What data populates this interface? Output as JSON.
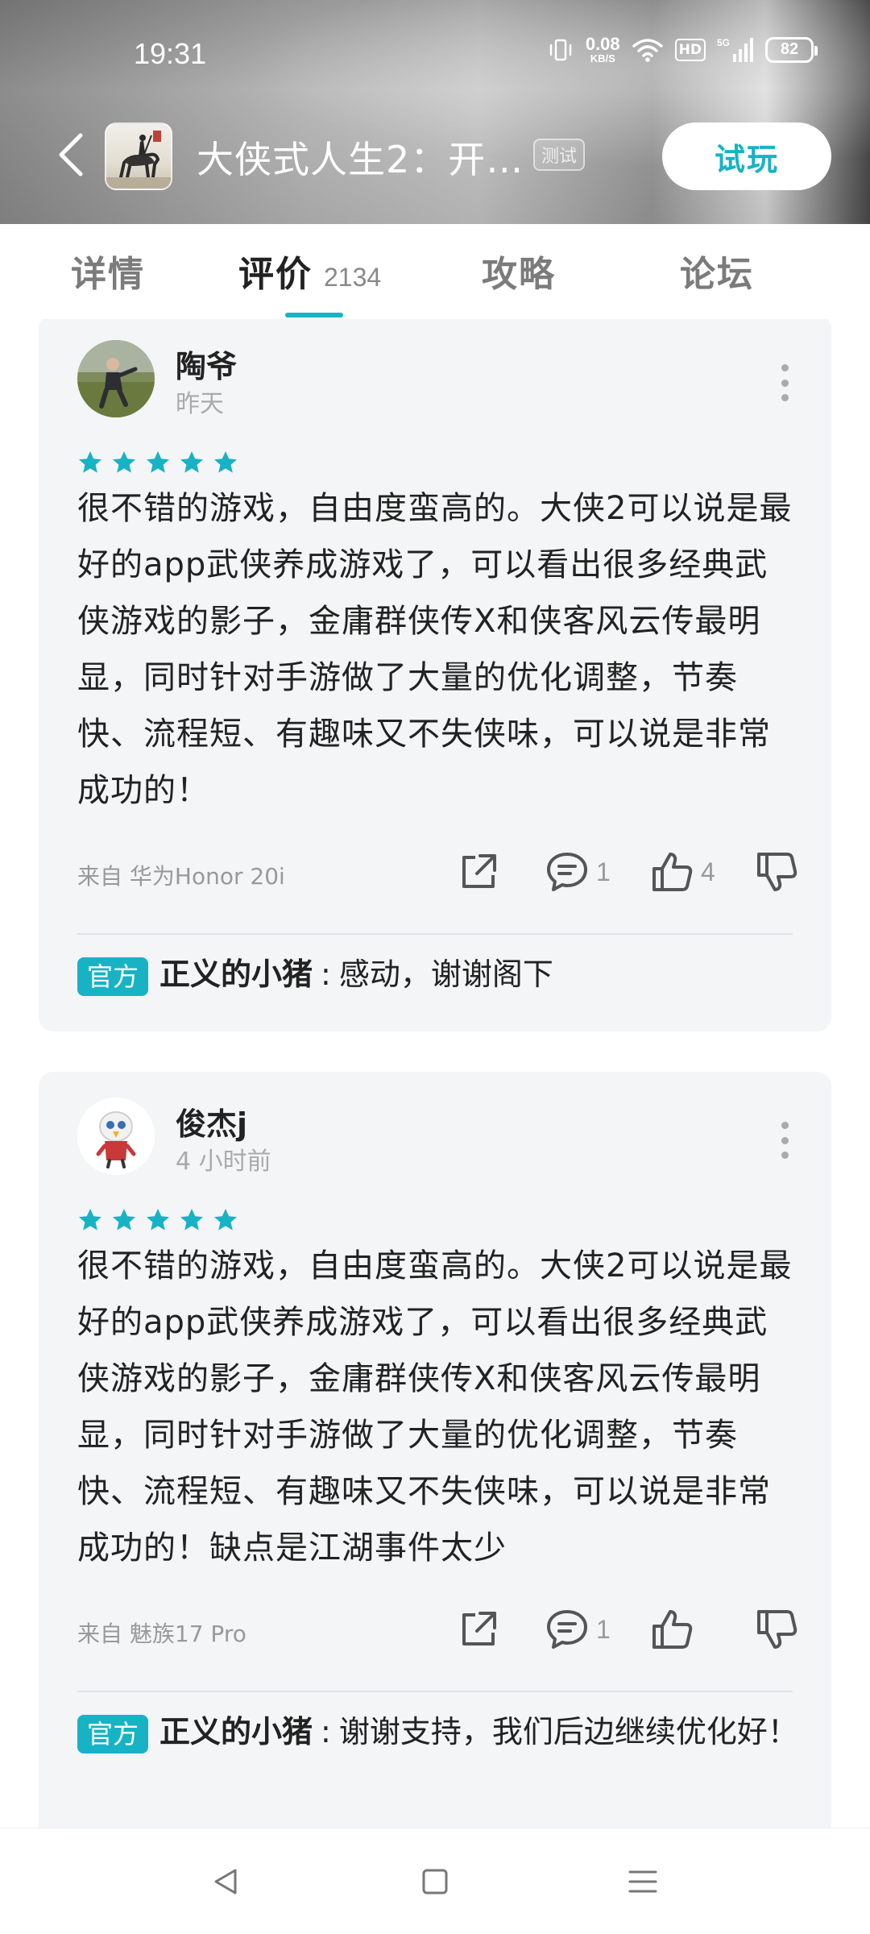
{
  "status_bar": {
    "time": "19:31",
    "net_speed_value": "0.08",
    "net_speed_unit": "KB/S",
    "hd_label": "HD",
    "network": "5G",
    "battery": "82",
    "icons": [
      "vibrate-icon",
      "wifi-icon",
      "hd-icon",
      "signal-icon",
      "battery-icon"
    ]
  },
  "header": {
    "title": "大侠式人生2：开…",
    "tag": "测试",
    "try_button": "试玩"
  },
  "tabs": [
    {
      "label": "详情"
    },
    {
      "label": "评价",
      "count": "2134"
    },
    {
      "label": "攻略"
    },
    {
      "label": "论坛"
    }
  ],
  "accent_color": "#17b3c4",
  "reviews": [
    {
      "user": "陶爷",
      "time": "昨天",
      "stars": 5,
      "text": "很不错的游戏，自由度蛮高的。大侠2可以说是最好的app武侠养成游戏了，可以看出很多经典武侠游戏的影子，金庸群侠传X和侠客风云传最明显，同时针对手游做了大量的优化调整，节奏快、流程短、有趣味又不失侠味，可以说是非常成功的！",
      "device": "来自 华为Honor 20i",
      "comment_count": "1",
      "like_count": "4",
      "reply": {
        "badge": "官方",
        "author": "正义的小猪",
        "separator": ":",
        "text": "感动，谢谢阁下"
      }
    },
    {
      "user": "俊杰j",
      "time": "4 小时前",
      "stars": 5,
      "text": "很不错的游戏，自由度蛮高的。大侠2可以说是最好的app武侠养成游戏了，可以看出很多经典武侠游戏的影子，金庸群侠传X和侠客风云传最明显，同时针对手游做了大量的优化调整，节奏快、流程短、有趣味又不失侠味，可以说是非常成功的！缺点是江湖事件太少",
      "device": "来自 魅族17 Pro",
      "comment_count": "1",
      "like_count": "",
      "reply": {
        "badge": "官方",
        "author": "正义的小猪",
        "separator": ":",
        "text": "谢谢支持，我们后边继续优化好！"
      }
    }
  ]
}
